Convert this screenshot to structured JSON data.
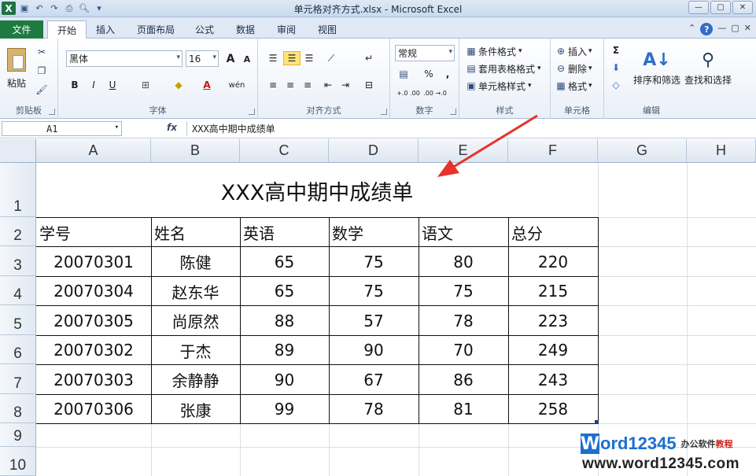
{
  "window": {
    "title": "单元格对齐方式.xlsx - Microsoft Excel",
    "logo": "X",
    "controls": [
      "—",
      "▢",
      "✕"
    ]
  },
  "tabs": {
    "file": "文件",
    "items": [
      "开始",
      "插入",
      "页面布局",
      "公式",
      "数据",
      "审阅",
      "视图"
    ]
  },
  "ribbon": {
    "clipboard": {
      "paste": "粘贴",
      "label": "剪贴板"
    },
    "font": {
      "name": "黑体",
      "size": "16",
      "label": "字体",
      "bold": "B",
      "italic": "I",
      "underline": "U",
      "grow": "A",
      "shrink": "A",
      "color_a": "A",
      "wen": "wén"
    },
    "alignment": {
      "label": "对齐方式"
    },
    "number": {
      "format": "常规",
      "percent": "%",
      "comma": ",",
      "inc": "+.0 .00",
      "dec": ".00 →.0",
      "label": "数字"
    },
    "styles": {
      "conditional": "条件格式",
      "table": "套用表格格式",
      "cell": "单元格样式",
      "label": "样式"
    },
    "cells": {
      "insert": "插入",
      "delete": "删除",
      "format": "格式",
      "label": "单元格"
    },
    "editing": {
      "sort": "排序和筛选",
      "find": "查找和选择",
      "label": "编辑",
      "sigma": "Σ"
    }
  },
  "formula_bar": {
    "name_box": "A1",
    "fx": "fx",
    "content": "XXX高中期中成绩单"
  },
  "sheet": {
    "columns": [
      "A",
      "B",
      "C",
      "D",
      "E",
      "F",
      "G",
      "H"
    ],
    "rows": [
      "1",
      "2",
      "3",
      "4",
      "5",
      "6",
      "7",
      "8",
      "9",
      "10"
    ],
    "title": "XXX高中期中成绩单",
    "headers": [
      "学号",
      "姓名",
      "英语",
      "数学",
      "语文",
      "总分"
    ],
    "data": [
      [
        "20070301",
        "陈健",
        "65",
        "75",
        "80",
        "220"
      ],
      [
        "20070304",
        "赵东华",
        "65",
        "75",
        "75",
        "215"
      ],
      [
        "20070305",
        "尚原然",
        "88",
        "57",
        "78",
        "223"
      ],
      [
        "20070302",
        "于杰",
        "89",
        "90",
        "70",
        "249"
      ],
      [
        "20070303",
        "余静静",
        "90",
        "67",
        "86",
        "243"
      ],
      [
        "20070306",
        "张康",
        "99",
        "78",
        "81",
        "258"
      ]
    ]
  },
  "watermark": {
    "letter": "W",
    "brand": "ord12345",
    "sub1": "办公软件",
    "sub2": "教程",
    "url": "www.word12345.com"
  },
  "colors": {
    "file_tab": "#1e7a41",
    "annotation_arrow": "#e8322a",
    "watermark_blue": "#1b6fd0"
  }
}
